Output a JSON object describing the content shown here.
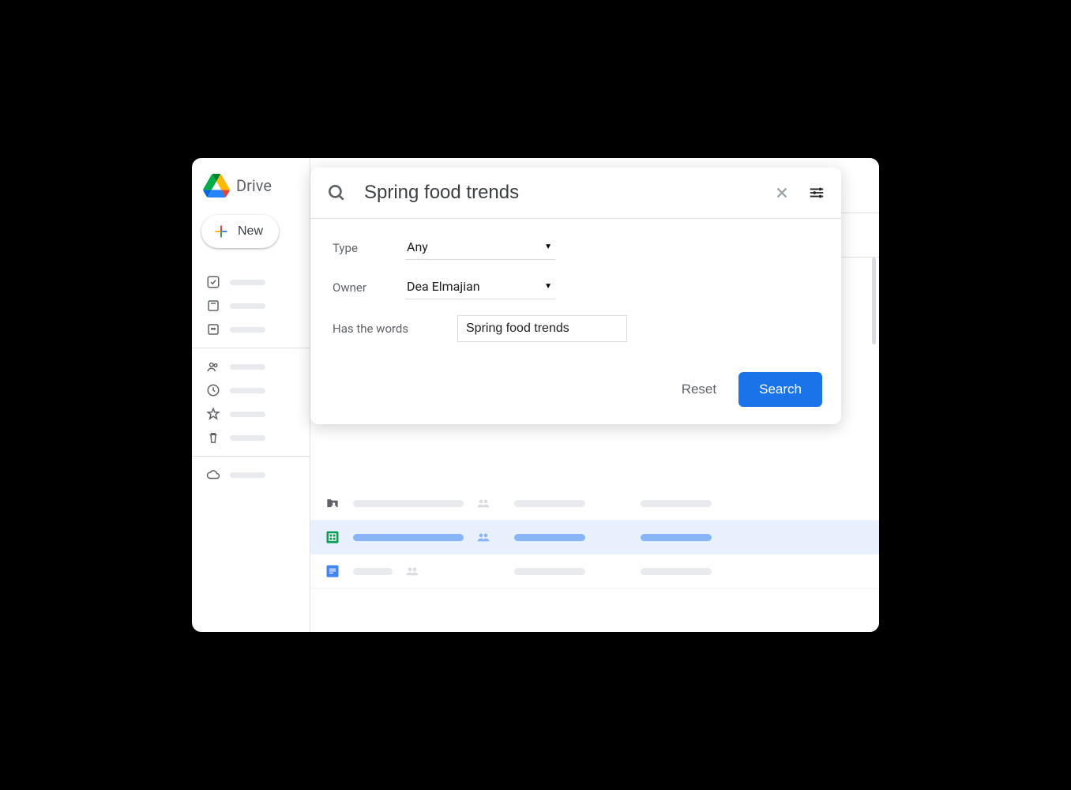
{
  "app": {
    "name": "Drive"
  },
  "sidebar": {
    "new_label": "New"
  },
  "search": {
    "query": "Spring food trends",
    "filters": {
      "type_label": "Type",
      "type_value": "Any",
      "owner_label": "Owner",
      "owner_value": "Dea Elmajian",
      "words_label": "Has the words",
      "words_value": "Spring food trends"
    },
    "reset_label": "Reset",
    "search_label": "Search"
  },
  "colors": {
    "primary": "#1a73e8",
    "selected_bg": "#e8f0fe",
    "muted": "#5f6368"
  }
}
